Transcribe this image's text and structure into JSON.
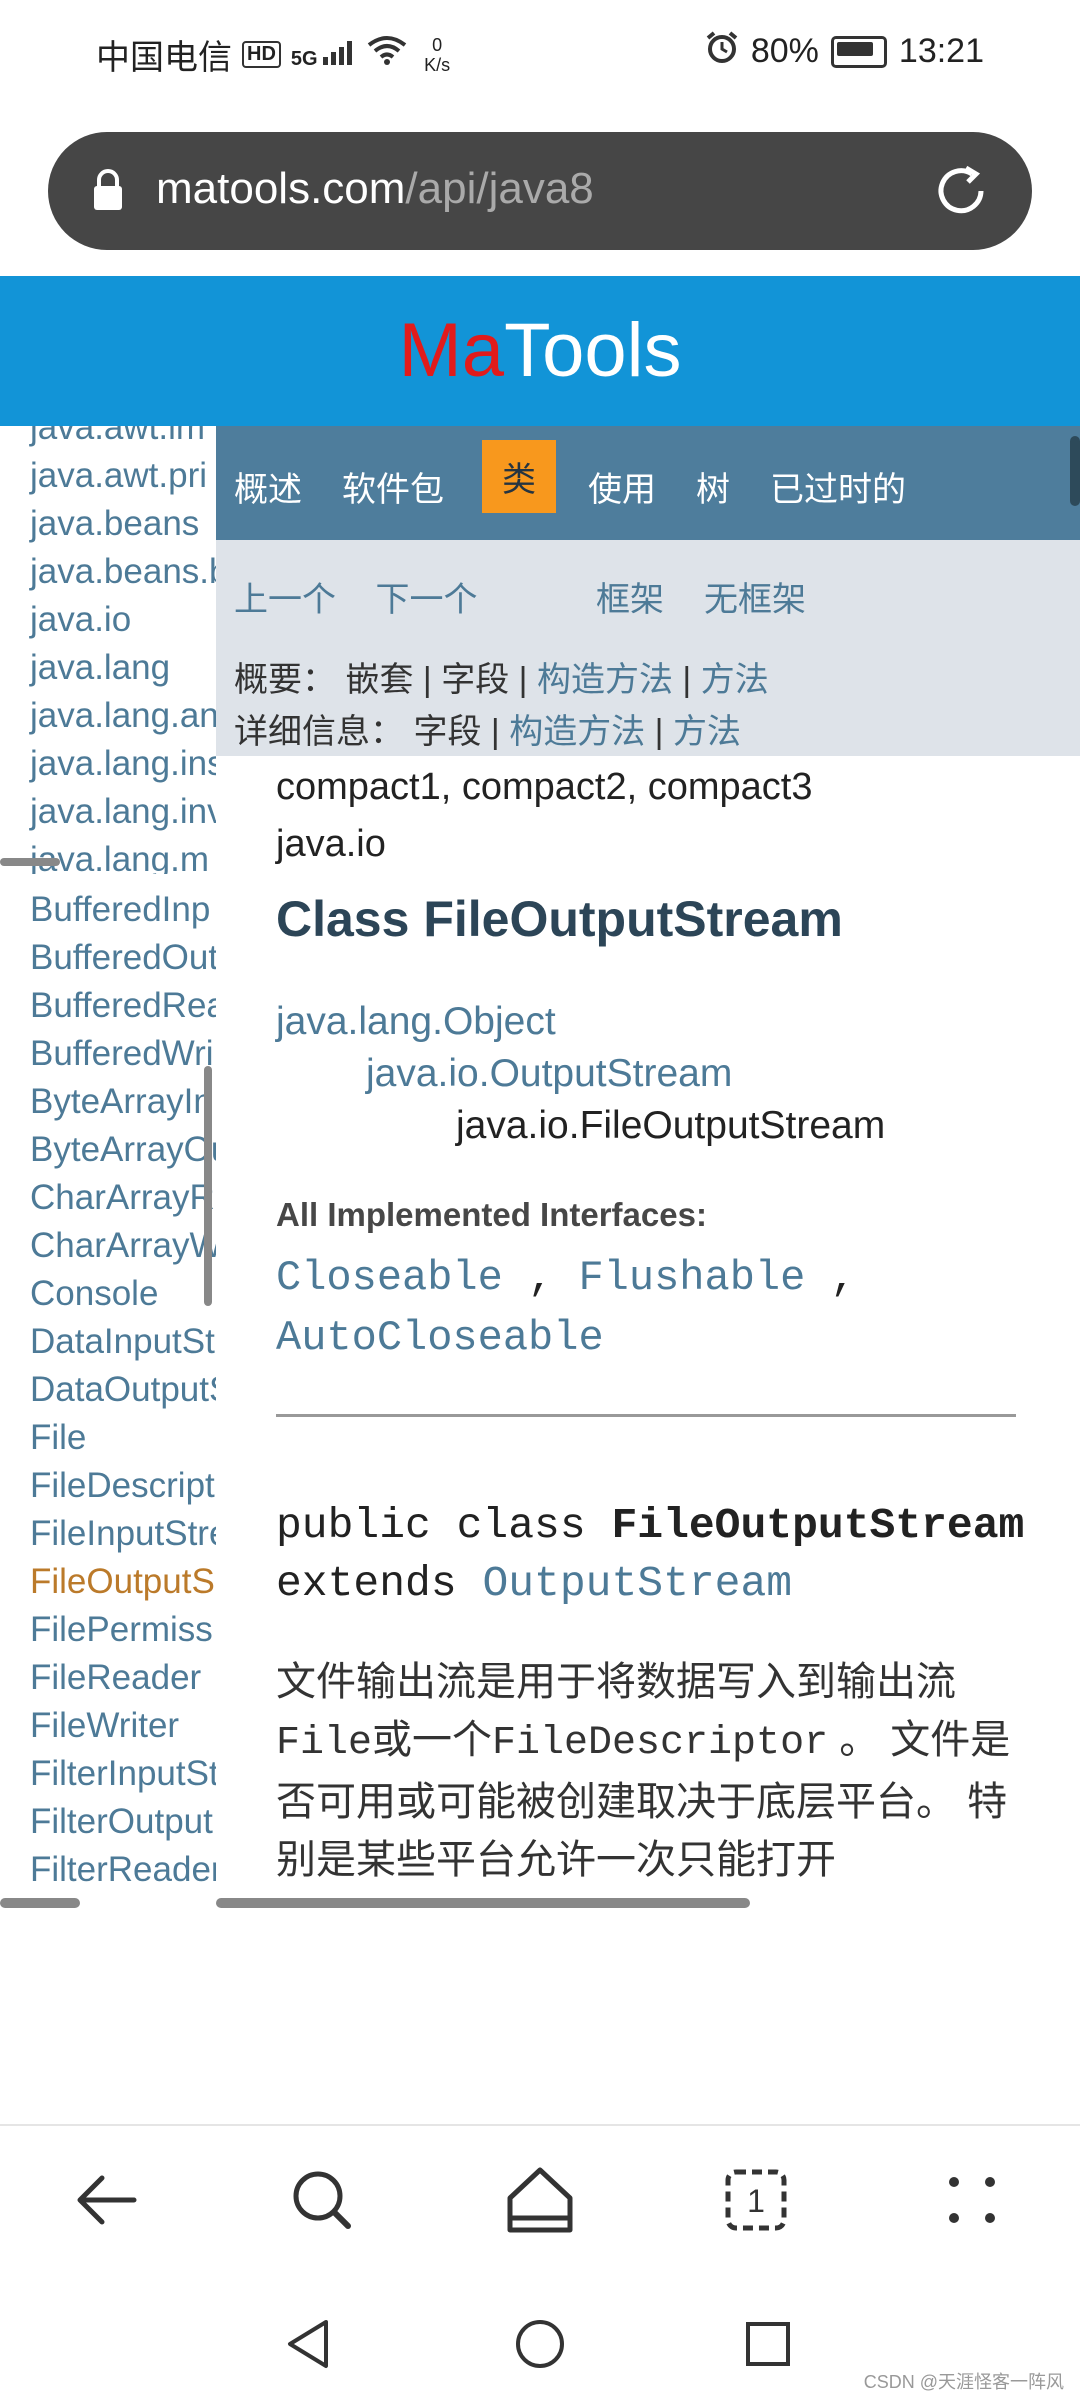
{
  "status_bar": {
    "carrier": "中国电信",
    "hd": "HD",
    "signal": "5G",
    "speed": "0 K/s",
    "battery": "80%",
    "time": "13:21"
  },
  "url_bar": {
    "domain": "matools.com",
    "path": "/api/java8"
  },
  "header": {
    "logo_ma": "Ma",
    "logo_tools": "Tools"
  },
  "sidebar": {
    "packages": [
      "java.awt.im",
      "java.awt.pri",
      "java.beans",
      "java.beans.b",
      "java.io",
      "java.lang",
      "java.lang.an",
      "java.lang.ins",
      "java.lang.inv",
      "java.lang.m"
    ],
    "classes": [
      "BufferedInp",
      "BufferedOut",
      "BufferedRea",
      "BufferedWri",
      "ByteArrayIn",
      "ByteArrayOu",
      "CharArrayRe",
      "CharArrayW",
      "Console",
      "DataInputSt",
      "DataOutputS",
      "File",
      "FileDescript",
      "FileInputStre",
      "FileOutputS",
      "FilePermiss",
      "FileReader",
      "FileWriter",
      "FilterInputSt",
      "FilterOutput",
      "FilterReader"
    ]
  },
  "navbar": {
    "items": [
      "概述",
      "软件包",
      "类",
      "使用",
      "树",
      "已过时的"
    ],
    "active": "类"
  },
  "subnav": {
    "prev": "上一个",
    "next": "下一个",
    "frames": "框架",
    "no_frames": "无框架",
    "summary_label": "概要：",
    "summary_nested": "嵌套",
    "summary_field": "字段",
    "summary_constr": "构造方法",
    "summary_method": "方法",
    "detail_label": "详细信息：",
    "detail_field": "字段",
    "detail_constr": "构造方法",
    "detail_method": "方法",
    "sep": "|"
  },
  "content": {
    "profiles": "compact1, compact2, compact3",
    "package": "java.io",
    "class_title": "Class FileOutputStream",
    "inheritance": [
      "java.lang.Object",
      "java.io.OutputStream",
      "java.io.FileOutputStream"
    ],
    "impl_title": "All Implemented Interfaces:",
    "interfaces": [
      "Closeable",
      "Flushable",
      "AutoCloseable"
    ],
    "sig_public_class": "public class ",
    "sig_name": "FileOutputStream",
    "sig_extends": "extends ",
    "sig_super": "OutputStream",
    "desc_1": "文件输出流是用于将数据写入到输出流",
    "desc_file": "File",
    "desc_or": "或一个",
    "desc_fd": "FileDescriptor",
    "desc_2": " 。 文件是否可用或可能被创建取决于底层平台。 特别是某些平台允许一次只能打开"
  },
  "watermark": "CSDN @天涯怪客一阵风"
}
